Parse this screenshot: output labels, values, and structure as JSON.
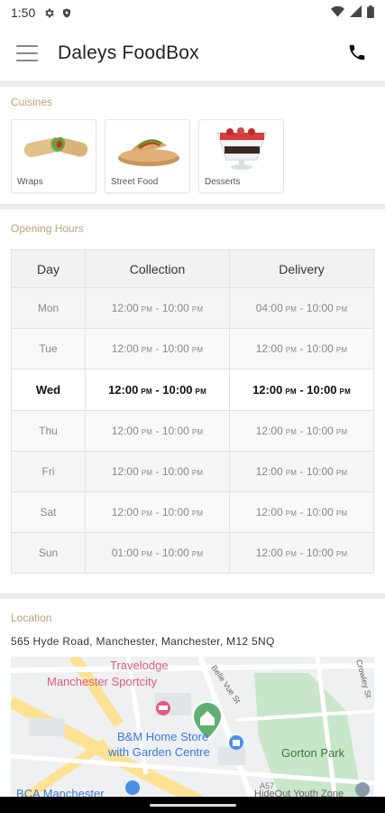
{
  "status_bar": {
    "time": "1:50"
  },
  "app_bar": {
    "title": "Daleys FoodBox"
  },
  "cuisines": {
    "section_label": "Cuisines",
    "items": [
      {
        "label": "Wraps"
      },
      {
        "label": "Street Food"
      },
      {
        "label": "Desserts"
      }
    ]
  },
  "opening_hours": {
    "section_label": "Opening Hours",
    "headers": {
      "day": "Day",
      "collection": "Collection",
      "delivery": "Delivery"
    },
    "rows": [
      {
        "day": "Mon",
        "collection": {
          "start": "12:00",
          "end": "10:00"
        },
        "delivery": {
          "start": "04:00",
          "end": "10:00"
        }
      },
      {
        "day": "Tue",
        "collection": {
          "start": "12:00",
          "end": "10:00"
        },
        "delivery": {
          "start": "12:00",
          "end": "10:00"
        }
      },
      {
        "day": "Wed",
        "collection": {
          "start": "12:00",
          "end": "10:00"
        },
        "delivery": {
          "start": "12:00",
          "end": "10:00"
        }
      },
      {
        "day": "Thu",
        "collection": {
          "start": "12:00",
          "end": "10:00"
        },
        "delivery": {
          "start": "12:00",
          "end": "10:00"
        }
      },
      {
        "day": "Fri",
        "collection": {
          "start": "12:00",
          "end": "10:00"
        },
        "delivery": {
          "start": "12:00",
          "end": "10:00"
        }
      },
      {
        "day": "Sat",
        "collection": {
          "start": "12:00",
          "end": "10:00"
        },
        "delivery": {
          "start": "12:00",
          "end": "10:00"
        }
      },
      {
        "day": "Sun",
        "collection": {
          "start": "01:00",
          "end": "10:00"
        },
        "delivery": {
          "start": "12:00",
          "end": "10:00"
        }
      }
    ],
    "ampm": "PM",
    "separator": " - "
  },
  "location": {
    "section_label": "Location",
    "address": "565 Hyde Road, Manchester, Manchester, M12 5NQ",
    "map_labels": {
      "travelodge_line1": "Travelodge",
      "travelodge_line2": "Manchester Sportcity",
      "bm_line1": "B&M Home Store",
      "bm_line2": "with Garden Centre",
      "gorton_park": "Gorton Park",
      "belle_vue": "Belle Vue St",
      "crowley": "Crowley St",
      "bca": "BCA Manchester",
      "youth_zone": "HideOut Youth Zone",
      "road_number": "A57"
    }
  },
  "colors": {
    "section_label": "#b6a57a",
    "map_park": "#c8e6c9",
    "map_road_major": "#fde293",
    "map_marker": "#5fb071",
    "map_poi_pink": "#e15c7a",
    "map_poi_blue": "#4a8fe7"
  }
}
